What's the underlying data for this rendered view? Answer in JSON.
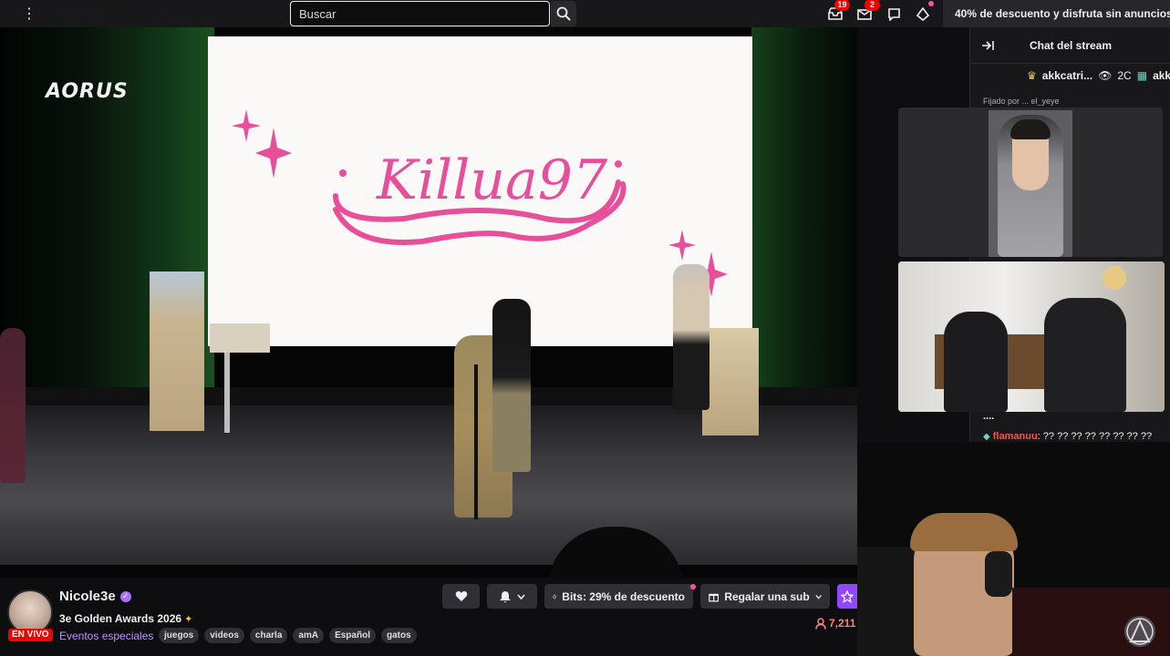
{
  "topbar": {
    "menu_icon": "vertical-ellipsis-icon",
    "search_placeholder": "Buscar",
    "notifications_badge": "19",
    "inbox_badge": "2",
    "promo_text": "40% de descuento y disfruta sin anuncios"
  },
  "video": {
    "screen_text": "Killua97",
    "sponsor_logo": "AORUS"
  },
  "chat": {
    "header": "Chat del stream",
    "viewer_row": {
      "user1": "akkcatri...",
      "views": "2C",
      "user2": "akkc"
    },
    "pinned_text": "Fijado por ... el_yeye",
    "message": {
      "username": "flamanuu",
      "text": ": ?? ?? ?? ?? ?? ?? ?? ??",
      "ellipsis": "...."
    }
  },
  "channel": {
    "live_label": "EN VIVO",
    "name": "Nicole3e",
    "stream_title": "3e Golden Awards 2026",
    "category": "Eventos especiales",
    "tags": [
      "juegos",
      "videos",
      "charla",
      "amA",
      "Español",
      "gatos"
    ],
    "viewer_count": "7,211"
  },
  "actions": {
    "bits_label": "Bits: 29% de descuento",
    "gift_label": "Regalar una sub"
  },
  "colors": {
    "brand_purple": "#9147ff",
    "live_red": "#eb0400",
    "screen_pink": "#e84f9a"
  }
}
